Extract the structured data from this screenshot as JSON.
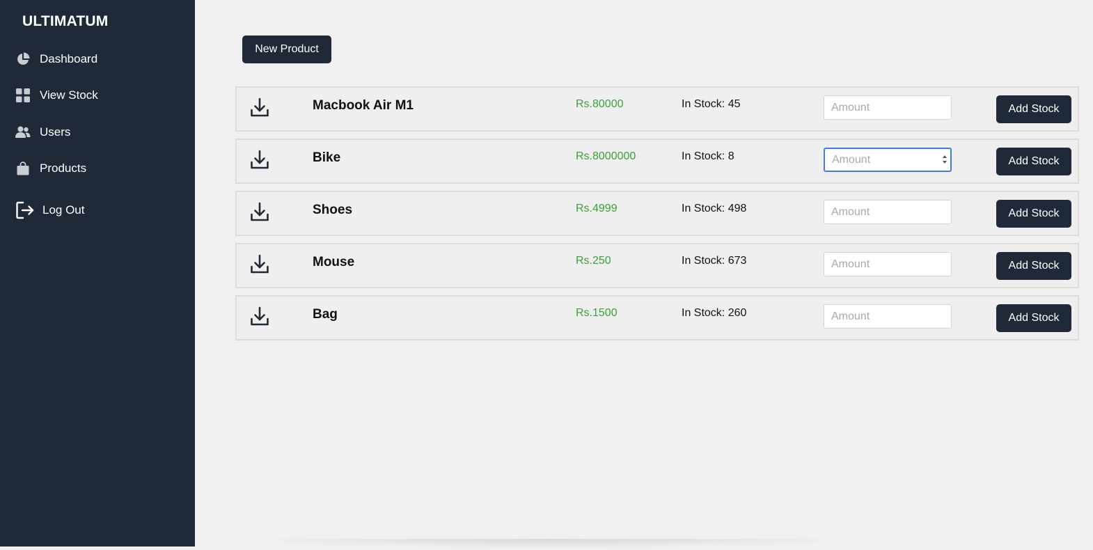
{
  "sidebar": {
    "brand": "ULTIMATUM",
    "items": [
      {
        "label": "Dashboard",
        "icon": "pie-chart-icon"
      },
      {
        "label": "View Stock",
        "icon": "grid-icon"
      },
      {
        "label": "Users",
        "icon": "users-icon"
      },
      {
        "label": "Products",
        "icon": "shopping-bag-icon"
      }
    ],
    "logout": {
      "label": "Log Out",
      "icon": "logout-icon"
    }
  },
  "main": {
    "new_product_label": "New Product",
    "amount_placeholder": "Amount",
    "add_stock_label": "Add Stock",
    "products": [
      {
        "name": "Macbook Air M1",
        "price": "Rs.80000",
        "stock": "In Stock: 45"
      },
      {
        "name": "Bike",
        "price": "Rs.8000000",
        "stock": "In Stock: 8"
      },
      {
        "name": "Shoes",
        "price": "Rs.4999",
        "stock": "In Stock: 498"
      },
      {
        "name": "Mouse",
        "price": "Rs.250",
        "stock": "In Stock: 673"
      },
      {
        "name": "Bag",
        "price": "Rs.1500",
        "stock": "In Stock: 260"
      }
    ]
  },
  "colors": {
    "sidebar_bg": "#1f2937",
    "page_bg": "#f0f0f0",
    "price_green": "#3aa13a",
    "focus_blue": "#3b7de0"
  }
}
